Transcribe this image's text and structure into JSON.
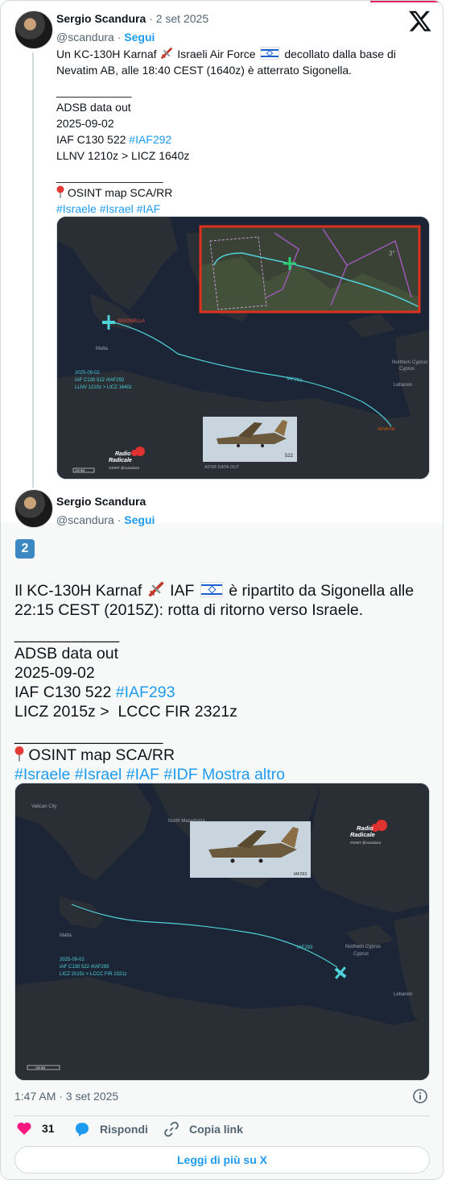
{
  "tweet1": {
    "author_name": "Sergio Scandura",
    "date": "2 set 2025",
    "handle": "@scandura",
    "dot": "·",
    "follow_label": "Segui",
    "text": {
      "line1_a": "Un KC-130H Karnaf",
      "line1_b": "Israeli Air Force",
      "line1_c": "decollato dalla base di",
      "line2": "Nevatim AB, alle 18:40 CEST (1640z) è atterrato Sigonella.",
      "separator1": "____________",
      "line4": "ADSB data out",
      "line5": "2025-09-02",
      "line6_a": "IAF C130 522",
      "line6_hash": "#IAF292",
      "line7": "LLNV 1210z > LICZ 1640z",
      "separator2": "_________________",
      "line9": "OSINT map SCA/RR",
      "hashtags": [
        "#Israele",
        "#Israel",
        "#IAF"
      ]
    },
    "map": {
      "label_sigonella": "SIGONELLA",
      "label_malta": "Malta",
      "label_cyprus": "Northern Cyprus",
      "label_cyprus2": "Cyprus",
      "label_lebanon": "Lebanon",
      "label_nevatim": "NEVATIM",
      "route_label": "IAF292",
      "info_line1": "2025-09-02",
      "info_line2": "IAF C130 522 #IAF292",
      "info_line3": "LLNV 1210z > LICZ 1640z",
      "photo_caption": "ADSB DATA OUT",
      "photo_tail": "522",
      "logo_line1": "Radio",
      "logo_line2": "Radicale",
      "logo_sub": "OSINT @scandura",
      "scale": "100 NM",
      "inset_num": "3°"
    }
  },
  "tweet2": {
    "author_name": "Sergio Scandura",
    "handle": "@scandura",
    "dot": "·",
    "follow_label": "Segui",
    "badge": "2",
    "text": {
      "line1_a": "Il KC-130H Karnaf",
      "line1_b": "IAF",
      "line1_c": "è ripartito da Sigonella alle",
      "line2": "22:15 CEST (2015Z): rotta di ritorno verso Israele.",
      "separator1": "____________",
      "line4": "ADSB data out",
      "line5": "2025-09-02",
      "line6_a": "IAF C130 522",
      "line6_hash": "#IAF293",
      "line7": "LICZ 2015z >  LCCC FIR 2321z",
      "separator2": "_________________",
      "line9": "OSINT map SCA/RR",
      "hashtags": [
        "#Israele",
        "#Israel",
        "#IAF",
        "#IDF"
      ],
      "show_more": "Mostra altro"
    },
    "map": {
      "label_vatican": "Vatican City",
      "label_north_macedonia": "North Macedonia",
      "label_malta": "Malta",
      "label_cyprus": "Northern Cyprus",
      "label_cyprus2": "Cyprus",
      "label_lebanon": "Lebanon",
      "route_label": "IAF293",
      "info_line1": "2025-09-02",
      "info_line2": "IAF C130 522 #IAF293",
      "info_line3": "LICZ 2015z >  LCCC FIR 2321z",
      "photo_tail": "IAF293",
      "logo_line1": "Radio",
      "logo_line2": "Radicale",
      "logo_sub": "OSINT @scandura",
      "scale": "100 NM"
    },
    "timestamp": "1:47 AM · 3 set 2025",
    "likes_count": "31",
    "reply_label": "Rispondi",
    "copy_label": "Copia link",
    "read_more_label": "Leggi di più su X"
  },
  "colors": {
    "accent": "#1d9bf0",
    "like": "#f91880",
    "map_sea": "#1c2535",
    "map_land": "#2a2f36",
    "route": "#4fd1d9",
    "highlight_box": "#e0301e"
  }
}
